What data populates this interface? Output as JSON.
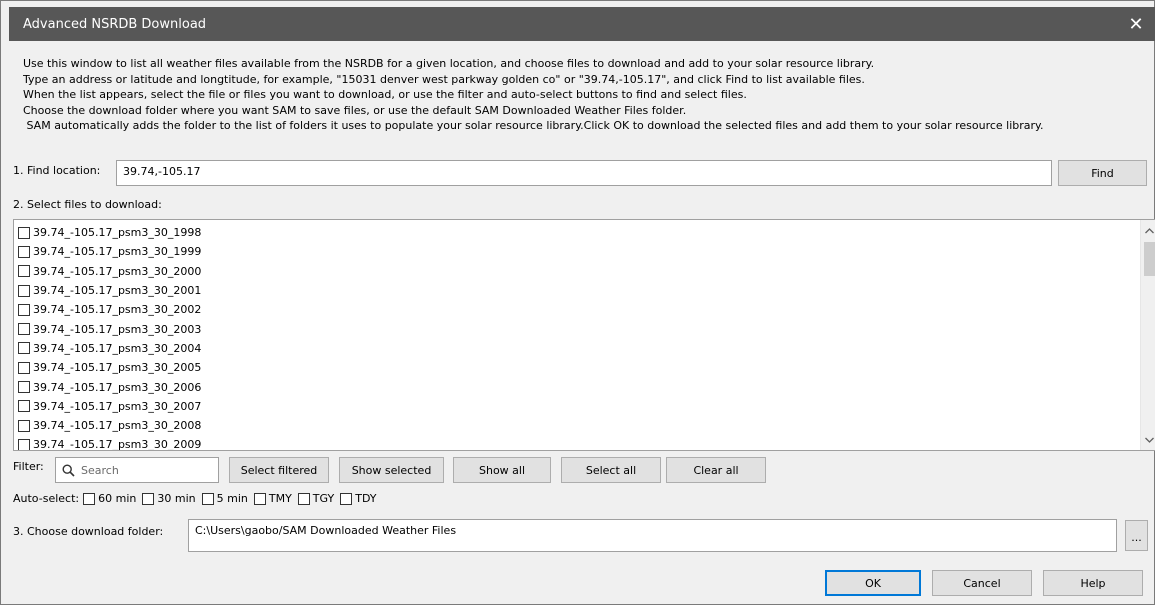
{
  "window": {
    "title": "Advanced NSRDB Download",
    "close_symbol": "✕"
  },
  "instructions": [
    "Use this window to list all weather files available from the NSRDB for a given location, and choose files to download and add to your solar resource library.",
    "Type an address or latitude and longtitude, for example, \"15031 denver west parkway golden co\" or \"39.74,-105.17\", and click Find to list available files.",
    "When the list appears, select the file or files you want to download, or use the filter and auto-select buttons to find and select files.",
    "Choose the download folder where you want SAM to save files, or use the default SAM Downloaded Weather Files folder.",
    " SAM automatically adds the folder to the list of folders it uses to populate your solar resource library.Click OK to download the selected files and add them to your solar resource library."
  ],
  "find": {
    "label": "1. Find location:",
    "value": "39.74,-105.17",
    "button": "Find"
  },
  "files": {
    "label": "2. Select files to download:",
    "items": [
      "39.74_-105.17_psm3_30_1998",
      "39.74_-105.17_psm3_30_1999",
      "39.74_-105.17_psm3_30_2000",
      "39.74_-105.17_psm3_30_2001",
      "39.74_-105.17_psm3_30_2002",
      "39.74_-105.17_psm3_30_2003",
      "39.74_-105.17_psm3_30_2004",
      "39.74_-105.17_psm3_30_2005",
      "39.74_-105.17_psm3_30_2006",
      "39.74_-105.17_psm3_30_2007",
      "39.74_-105.17_psm3_30_2008",
      "39.74_-105.17_psm3_30_2009"
    ]
  },
  "filter": {
    "label": "Filter:",
    "placeholder": "Search",
    "buttons": [
      "Select filtered",
      "Show selected",
      "Show all",
      "Select all",
      "Clear all"
    ]
  },
  "autoselect": {
    "label": "Auto-select:",
    "options": [
      "60 min",
      "30 min",
      "5 min",
      "TMY",
      "TGY",
      "TDY"
    ]
  },
  "folder": {
    "label": "3. Choose download folder:",
    "value": "C:\\Users\\gaobo/SAM Downloaded Weather Files",
    "browse": "..."
  },
  "footer": {
    "ok": "OK",
    "cancel": "Cancel",
    "help": "Help"
  },
  "colors": {
    "titlebar": "#575757",
    "dialog": "#f0f0f0",
    "default_button_border": "#0078d7"
  },
  "icons": {
    "close": "close-icon",
    "search": "search-icon",
    "scroll_up": "chevron-up-icon",
    "scroll_down": "chevron-down-icon"
  }
}
